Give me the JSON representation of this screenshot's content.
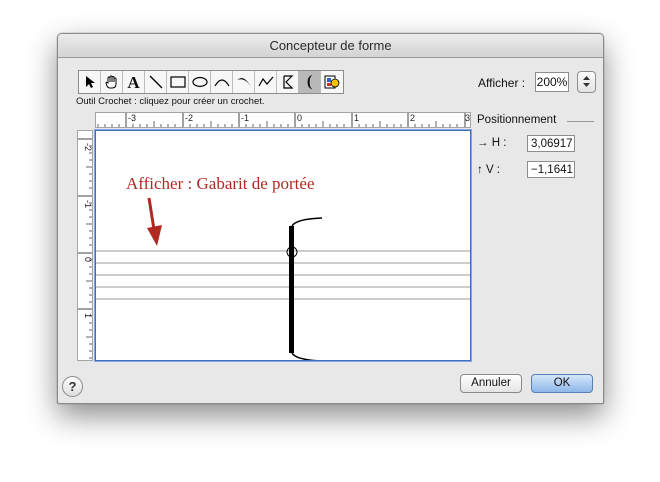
{
  "window": {
    "title": "Concepteur de forme"
  },
  "toolbar": {
    "tools": [
      {
        "icon": "arrow-pointer-icon"
      },
      {
        "icon": "hand-icon"
      },
      {
        "icon": "text-tool-icon",
        "label": "A"
      },
      {
        "icon": "line-tool-icon"
      },
      {
        "icon": "rectangle-tool-icon"
      },
      {
        "icon": "ellipse-tool-icon"
      },
      {
        "icon": "arc-tool-icon"
      },
      {
        "icon": "slur-tool-icon"
      },
      {
        "icon": "polygon-tool-icon"
      },
      {
        "icon": "bracket-tool-icon"
      },
      {
        "icon": "bracket-selected-icon",
        "label": "("
      },
      {
        "icon": "color-fill-icon"
      }
    ],
    "hint": "Outil Crochet : cliquez pour créer un crochet."
  },
  "zoom": {
    "label": "Afficher :",
    "value": "200%"
  },
  "positioning": {
    "title": "Positionnement",
    "h_label": "→ H :",
    "h_value": "3,06917",
    "v_label": "↑ V :",
    "v_value": "−1,1641"
  },
  "ruler": {
    "top_labels": [
      "-3",
      "-2",
      "-1",
      "0",
      "1",
      "2",
      "3"
    ],
    "left_labels": [
      "-2",
      "-1",
      "0",
      "1"
    ]
  },
  "canvas": {
    "annotation_text": "Afficher : Gabarit de portée",
    "annotation_color": "#b12a22"
  },
  "buttons": {
    "help": "?",
    "cancel": "Annuler",
    "ok": "OK"
  },
  "colors": {
    "accent": "#3e6fbf",
    "default_button": "#8fb7ea"
  }
}
